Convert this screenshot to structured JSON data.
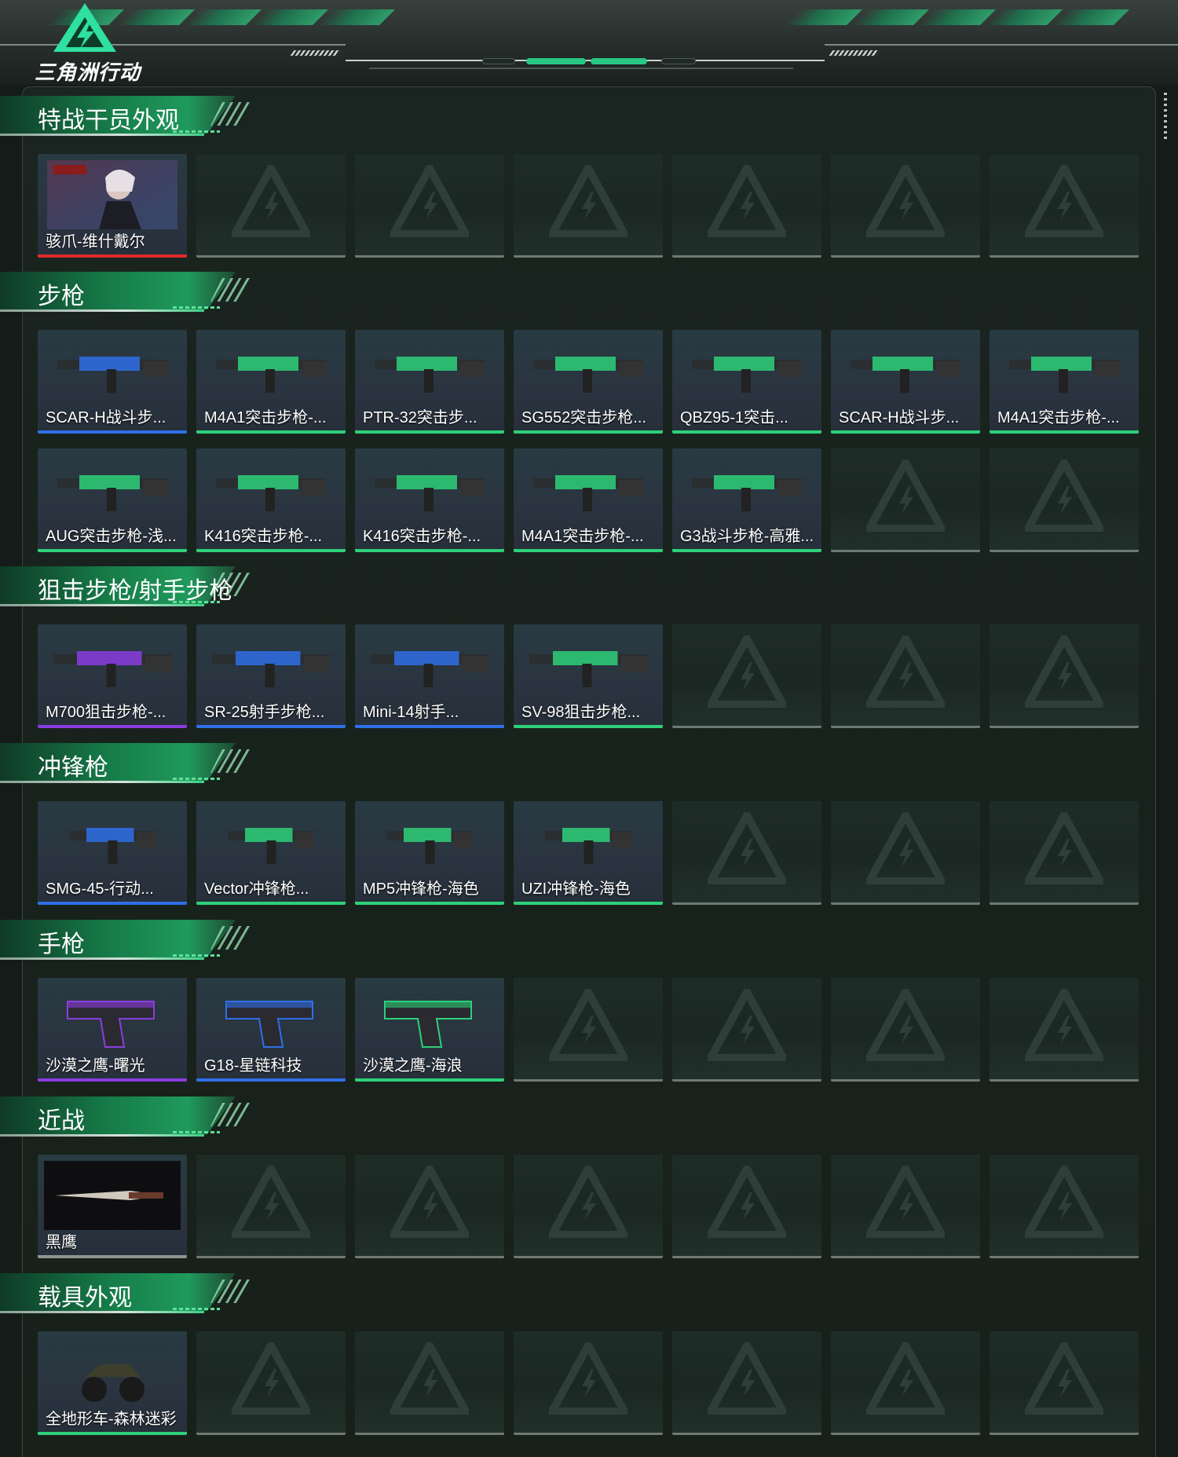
{
  "header": {
    "logo_text": "三角洲行动",
    "accent": "#27c884"
  },
  "colors": {
    "red": "#e02a2a",
    "blue": "#2f6fe8",
    "green": "#2ed07a",
    "purple": "#8a3de0",
    "gray": "#8d9591"
  },
  "sections": [
    {
      "title": "特战干员外观",
      "rows": [
        [
          {
            "label": "骇爪-维什戴尔",
            "rarity": "red",
            "icon": "operator-portrait-icon"
          },
          null,
          null,
          null,
          null,
          null,
          null
        ]
      ]
    },
    {
      "title": "步枪",
      "rows": [
        [
          {
            "label": "SCAR-H战斗步...",
            "rarity": "blue",
            "icon": "rifle-icon"
          },
          {
            "label": "M4A1突击步枪-...",
            "rarity": "green",
            "icon": "rifle-icon"
          },
          {
            "label": "PTR-32突击步...",
            "rarity": "green",
            "icon": "rifle-icon"
          },
          {
            "label": "SG552突击步枪...",
            "rarity": "green",
            "icon": "rifle-icon"
          },
          {
            "label": "QBZ95-1突击...",
            "rarity": "green",
            "icon": "rifle-icon"
          },
          {
            "label": "SCAR-H战斗步...",
            "rarity": "green",
            "icon": "rifle-icon"
          },
          {
            "label": "M4A1突击步枪-...",
            "rarity": "green",
            "icon": "rifle-icon"
          }
        ],
        [
          {
            "label": "AUG突击步枪-浅...",
            "rarity": "green",
            "icon": "rifle-icon"
          },
          {
            "label": "K416突击步枪-...",
            "rarity": "green",
            "icon": "rifle-icon"
          },
          {
            "label": "K416突击步枪-...",
            "rarity": "green",
            "icon": "rifle-icon"
          },
          {
            "label": "M4A1突击步枪-...",
            "rarity": "green",
            "icon": "rifle-icon"
          },
          {
            "label": "G3战斗步枪-高雅...",
            "rarity": "green",
            "icon": "rifle-icon"
          },
          null,
          null
        ]
      ]
    },
    {
      "title": "狙击步枪/射手步枪",
      "rows": [
        [
          {
            "label": "M700狙击步枪-...",
            "rarity": "purple",
            "icon": "sniper-rifle-icon"
          },
          {
            "label": "SR-25射手步枪...",
            "rarity": "blue",
            "icon": "sniper-rifle-icon"
          },
          {
            "label": "Mini-14射手...",
            "rarity": "blue",
            "icon": "sniper-rifle-icon"
          },
          {
            "label": "SV-98狙击步枪...",
            "rarity": "green",
            "icon": "sniper-rifle-icon"
          },
          null,
          null,
          null
        ]
      ]
    },
    {
      "title": "冲锋枪",
      "rows": [
        [
          {
            "label": "SMG-45-行动...",
            "rarity": "blue",
            "icon": "smg-icon"
          },
          {
            "label": "Vector冲锋枪...",
            "rarity": "green",
            "icon": "smg-icon"
          },
          {
            "label": "MP5冲锋枪-海色",
            "rarity": "green",
            "icon": "smg-icon"
          },
          {
            "label": "UZI冲锋枪-海色",
            "rarity": "green",
            "icon": "smg-icon"
          },
          null,
          null,
          null
        ]
      ]
    },
    {
      "title": "手枪",
      "rows": [
        [
          {
            "label": "沙漠之鹰-曙光",
            "rarity": "purple",
            "icon": "pistol-icon"
          },
          {
            "label": "G18-星链科技",
            "rarity": "blue",
            "icon": "pistol-icon"
          },
          {
            "label": "沙漠之鹰-海浪",
            "rarity": "green",
            "icon": "pistol-icon"
          },
          null,
          null,
          null,
          null
        ]
      ]
    },
    {
      "title": "近战",
      "rows": [
        [
          {
            "label": "黑鹰",
            "rarity": "gray",
            "icon": "knife-icon"
          },
          null,
          null,
          null,
          null,
          null,
          null
        ]
      ]
    },
    {
      "title": "载具外观",
      "rows": [
        [
          {
            "label": "全地形车-森林迷彩",
            "rarity": "green",
            "icon": "atv-vehicle-icon"
          },
          null,
          null,
          null,
          null,
          null,
          null
        ]
      ]
    }
  ]
}
